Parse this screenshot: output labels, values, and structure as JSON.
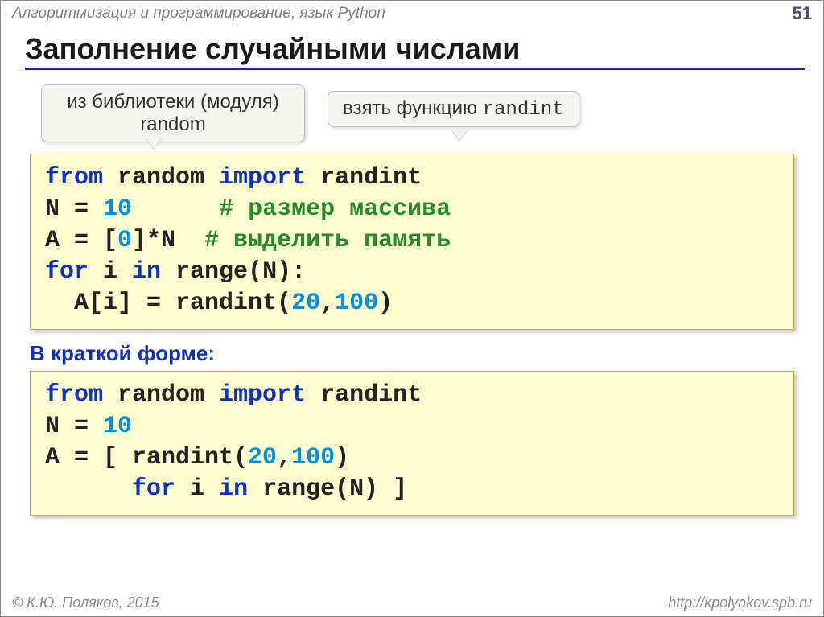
{
  "header": {
    "breadcrumb": "Алгоритмизация и программирование, язык Python",
    "page_number": "51"
  },
  "title": "Заполнение случайными числами",
  "bubbles": {
    "left_line1": "из библиотеки (модуля)",
    "left_line2": "random",
    "right_prefix": "взять функцию ",
    "right_mono": "randint"
  },
  "code1": {
    "kw_from": "from",
    "t_random": " random ",
    "kw_import": "import",
    "t_randint": " randint",
    "line2a": "N = ",
    "num10": "10",
    "line2b": "      ",
    "cmt1": "# размер массива",
    "line3a": "A = [",
    "num0": "0",
    "line3b": "]*N  ",
    "cmt2": "# выделить память",
    "kw_for": "for",
    "t_i": " i ",
    "kw_in": "in",
    "t_range": " range(N):",
    "line5a": "  A[i] = randint(",
    "num20": "20",
    "comma": ",",
    "num100": "100",
    "line5b": ")"
  },
  "subhead": "В краткой форме:",
  "code2": {
    "kw_from": "from",
    "t_random": " random ",
    "kw_import": "import",
    "t_randint": " randint",
    "line2a": "N = ",
    "num10": "10",
    "line3a": "A = [ randint(",
    "num20": "20",
    "comma": ",",
    "num100": "100",
    "line3b": ") ",
    "indent": "      ",
    "kw_for": "for",
    "t_i": " i ",
    "kw_in": "in",
    "t_range": " range(N) ]"
  },
  "footer": {
    "copyright": "© К.Ю. Поляков, 2015",
    "url": "http://kpolyakov.spb.ru"
  }
}
